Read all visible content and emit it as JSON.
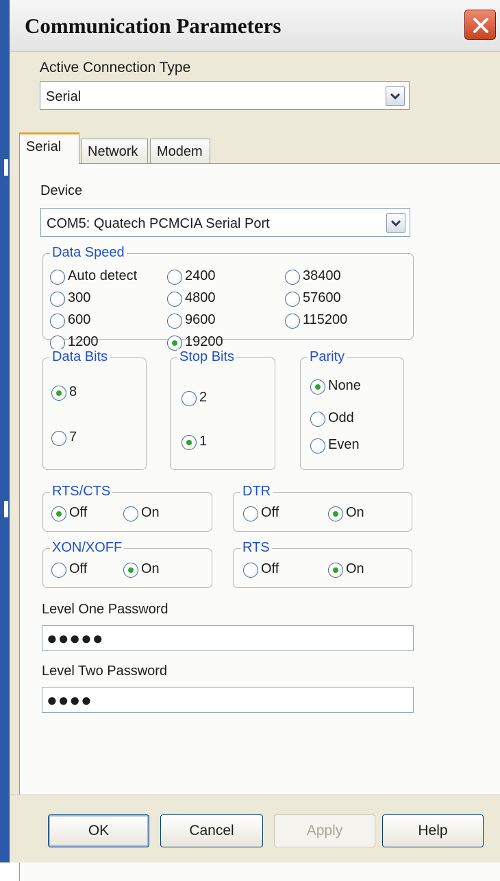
{
  "window": {
    "title": "Communication Parameters",
    "close_icon": "close-icon"
  },
  "connection": {
    "label": "Active Connection Type",
    "value": "Serial"
  },
  "tabs": [
    {
      "label": "Serial",
      "active": true
    },
    {
      "label": "Network",
      "active": false
    },
    {
      "label": "Modem",
      "active": false
    }
  ],
  "device": {
    "label": "Device",
    "value": "COM5: Quatech PCMCIA Serial Port"
  },
  "data_speed": {
    "legend": "Data Speed",
    "options": [
      "Auto detect",
      "2400",
      "38400",
      "300",
      "4800",
      "57600",
      "600",
      "9600",
      "115200",
      "1200",
      "19200"
    ],
    "selected": "19200"
  },
  "data_bits": {
    "legend": "Data Bits",
    "options": [
      "8",
      "7"
    ],
    "selected": "8"
  },
  "stop_bits": {
    "legend": "Stop Bits",
    "options": [
      "2",
      "1"
    ],
    "selected": "1"
  },
  "parity": {
    "legend": "Parity",
    "options": [
      "None",
      "Odd",
      "Even"
    ],
    "selected": "None"
  },
  "rts_cts": {
    "legend": "RTS/CTS",
    "options": [
      "Off",
      "On"
    ],
    "selected": "Off"
  },
  "dtr": {
    "legend": "DTR",
    "options": [
      "Off",
      "On"
    ],
    "selected": "On"
  },
  "xon_xoff": {
    "legend": "XON/XOFF",
    "options": [
      "Off",
      "On"
    ],
    "selected": "On"
  },
  "rts": {
    "legend": "RTS",
    "options": [
      "Off",
      "On"
    ],
    "selected": "On"
  },
  "password_one": {
    "label": "Level One Password",
    "masked_value": "●●●●●"
  },
  "password_two": {
    "label": "Level Two Password",
    "masked_value": "●●●●"
  },
  "buttons": {
    "ok": "OK",
    "cancel": "Cancel",
    "apply": "Apply",
    "help": "Help"
  },
  "colors": {
    "legend_blue": "#1f4fcc",
    "radio_selected_green": "#2fa62f",
    "close_button_red": "#c9421f",
    "tab_highlight_orange": "#e4a13a"
  }
}
